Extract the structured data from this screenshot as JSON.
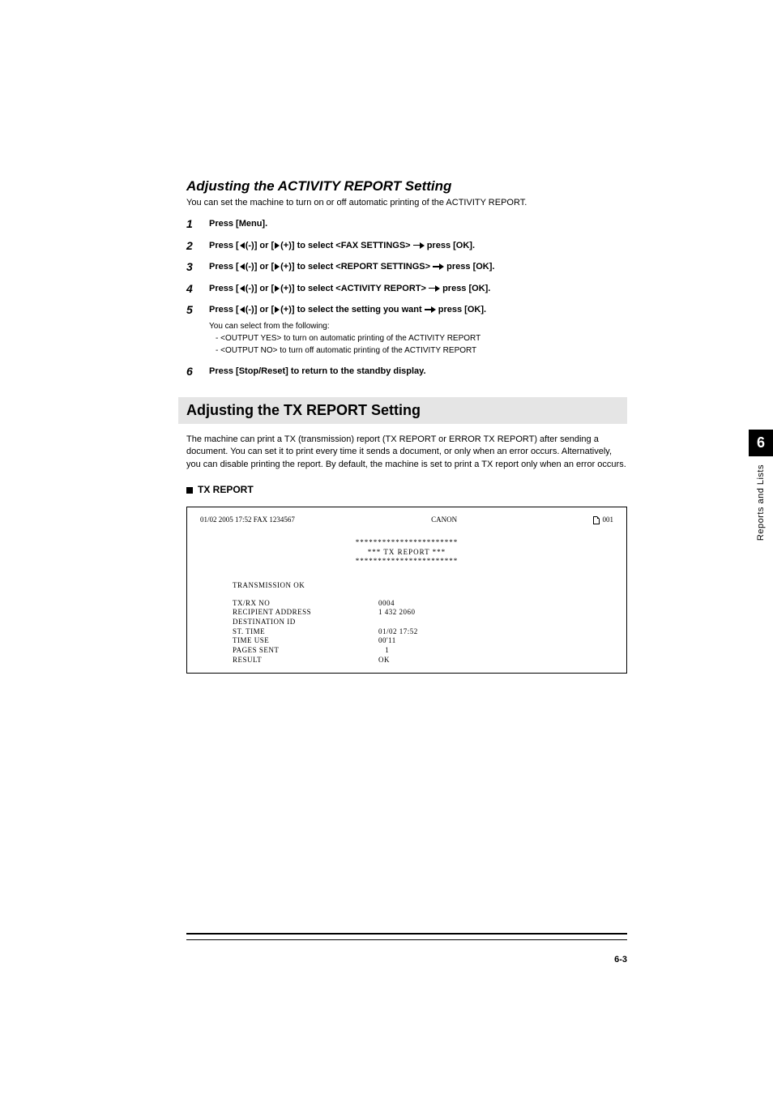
{
  "section1": {
    "title": "Adjusting the ACTIVITY REPORT Setting",
    "desc": "You can set the machine to turn on or off automatic printing of the ACTIVITY REPORT."
  },
  "steps": {
    "s1": "Press [Menu].",
    "s2a": "Press [",
    "s2b": "(-)] or [",
    "s2c": "(+)] to select <FAX SETTINGS> ",
    "s2d": " press [OK].",
    "s3a": "Press [",
    "s3b": "(-)] or [",
    "s3c": "(+)] to select <REPORT SETTINGS> ",
    "s3d": " press [OK].",
    "s4a": "Press [",
    "s4b": "(-)] or [",
    "s4c": "(+)] to select <ACTIVITY REPORT> ",
    "s4d": " press [OK].",
    "s5a": "Press [",
    "s5b": "(-)] or [",
    "s5c": "(+)] to select the setting you want ",
    "s5d": " press [OK].",
    "s5sub1": "You can select from the following:",
    "s5sub2": "-  <OUTPUT YES> to turn on automatic printing of the ACTIVITY REPORT",
    "s5sub3": "-  <OUTPUT NO> to turn off automatic printing of the ACTIVITY REPORT",
    "s6": "Press [Stop/Reset] to return to the standby display."
  },
  "section2": {
    "heading": "Adjusting the TX REPORT Setting",
    "desc": "The machine can print a TX (transmission) report (TX REPORT or ERROR TX REPORT) after sending a document. You can set it to print every time it sends a document, or only when an error occurs. Alternatively, you can disable printing the report. By default, the machine is set to print a TX report only when an error occurs.",
    "subheading": "TX REPORT"
  },
  "report": {
    "header_left": "01/02 2005  17:52  FAX 1234567",
    "header_center": "CANON",
    "header_right": "001",
    "stars": "***********************",
    "title": "***      TX REPORT      ***",
    "trans": "TRANSMISSION OK",
    "k1": "TX/RX NO",
    "v1": "0004",
    "k2": "RECIPIENT ADDRESS",
    "v2": "1 432 2060",
    "k3": "DESTINATION ID",
    "v3": "",
    "k4": "ST. TIME",
    "v4": "01/02 17:52",
    "k5": "TIME USE",
    "v5": "00'11",
    "k6": "PAGES SENT",
    "v6": "   1",
    "k7": "RESULT",
    "v7": "OK"
  },
  "side": {
    "num": "6",
    "label": "Reports and Lists"
  },
  "pagenum": "6-3"
}
